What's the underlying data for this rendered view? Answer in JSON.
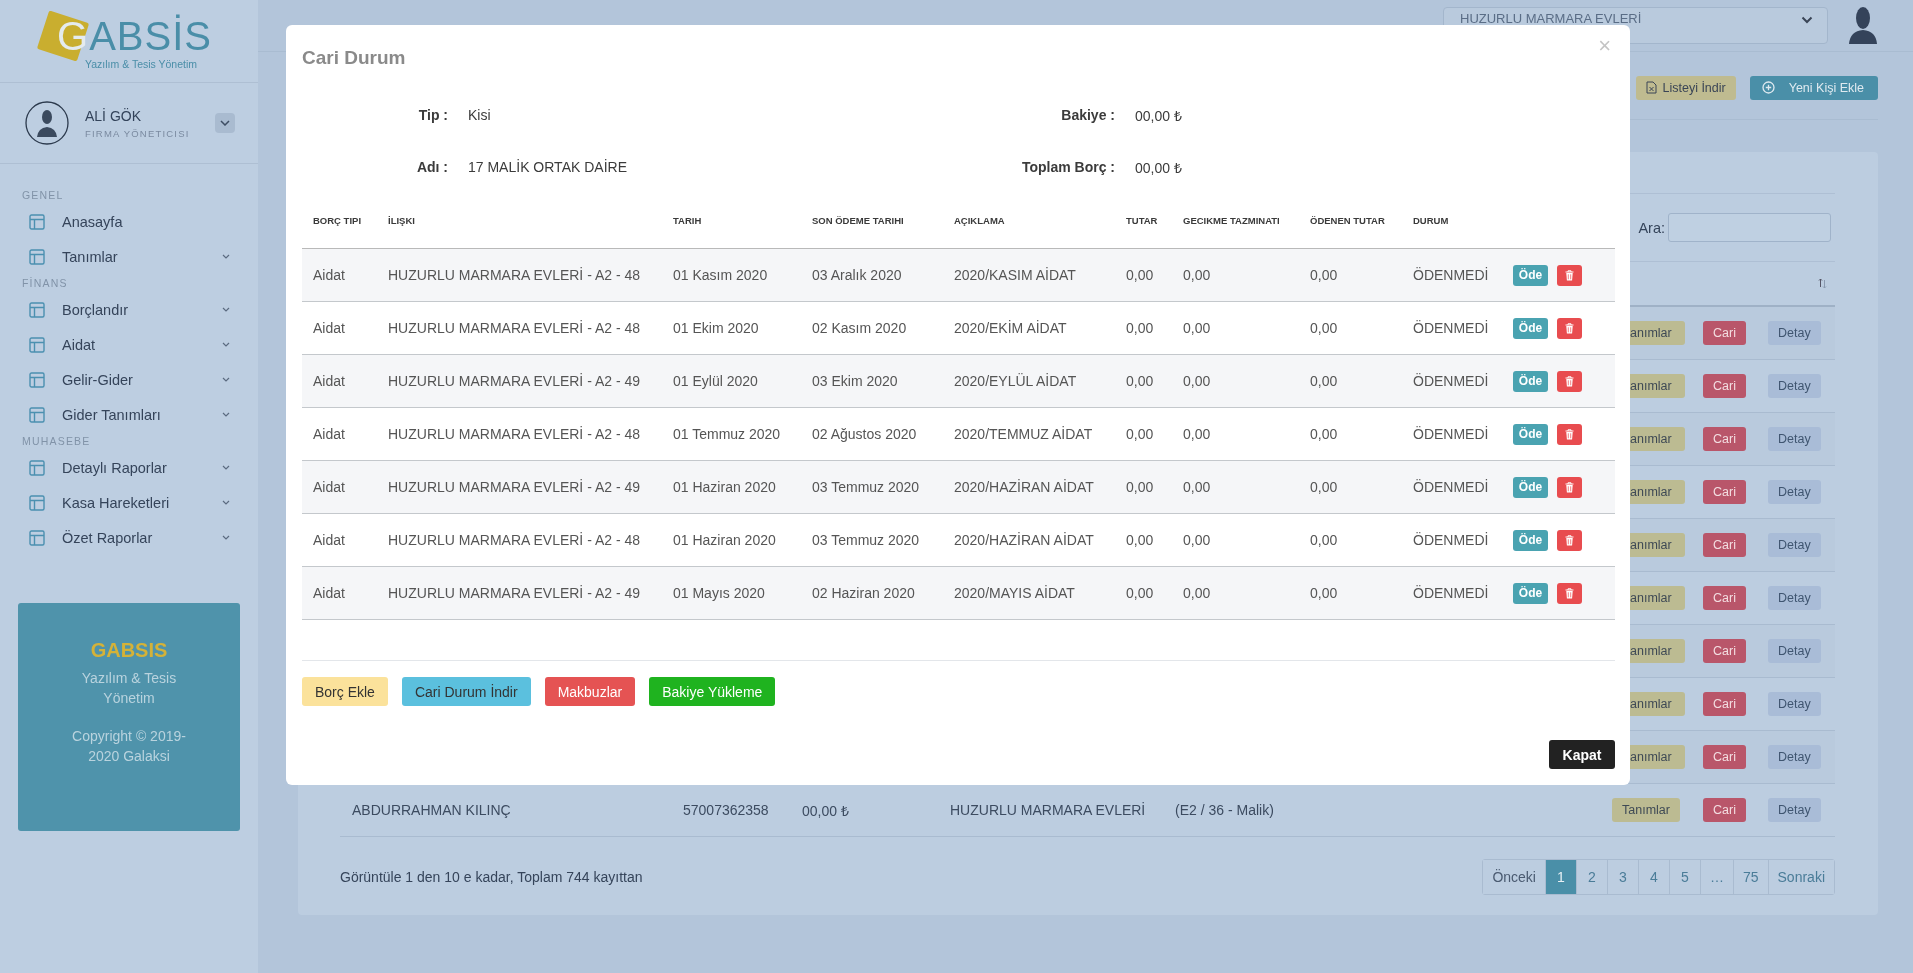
{
  "sidebar": {
    "logo": {
      "name": "GABSİS",
      "tagline": "Yazılım & Tesis Yönetim"
    },
    "user": {
      "name": "ALİ GÖK",
      "role": "FIRMA YÖNETICISI"
    },
    "sections": [
      {
        "title": "GENEL",
        "items": [
          {
            "label": "Anasayfa",
            "expandable": false
          },
          {
            "label": "Tanımlar",
            "expandable": true
          }
        ]
      },
      {
        "title": "FİNANS",
        "items": [
          {
            "label": "Borçlandır",
            "expandable": true
          },
          {
            "label": "Aidat",
            "expandable": true
          },
          {
            "label": "Gelir-Gider",
            "expandable": true
          },
          {
            "label": "Gider Tanımları",
            "expandable": true
          }
        ]
      },
      {
        "title": "MUHASEBE",
        "items": [
          {
            "label": "Detaylı Raporlar",
            "expandable": true
          },
          {
            "label": "Kasa Hareketleri",
            "expandable": true
          },
          {
            "label": "Özet Raporlar",
            "expandable": true
          }
        ]
      }
    ],
    "promo": {
      "title": "GABSIS",
      "text": "Yazılım & Tesis Yönetim",
      "copyright": "Copyright © 2019-2020 Galaksi"
    }
  },
  "topbar": {
    "site": "HUZURLU MARMARA EVLERİ"
  },
  "toolbar": [
    {
      "label": "Listeyi İndir",
      "kind": "download"
    },
    {
      "label": "Yeni Kişi Ekle",
      "kind": "add"
    }
  ],
  "list": {
    "search_label": "Ara:",
    "rows": [
      {
        "actions": [
          {
            "label": "anımlar",
            "kind": "define",
            "cut": true
          },
          {
            "label": "Cari",
            "kind": "account",
            "cut": false
          },
          {
            "label": "Detay",
            "kind": "detail",
            "cut": false
          }
        ]
      },
      {
        "actions": [
          {
            "label": "anımlar",
            "kind": "define",
            "cut": true
          },
          {
            "label": "Cari",
            "kind": "account",
            "cut": false
          },
          {
            "label": "Detay",
            "kind": "detail",
            "cut": false
          }
        ]
      },
      {
        "actions": [
          {
            "label": "anımlar",
            "kind": "define",
            "cut": true
          },
          {
            "label": "Cari",
            "kind": "account",
            "cut": false
          },
          {
            "label": "Detay",
            "kind": "detail",
            "cut": false
          }
        ]
      },
      {
        "actions": [
          {
            "label": "anımlar",
            "kind": "define",
            "cut": true
          },
          {
            "label": "Cari",
            "kind": "account",
            "cut": false
          },
          {
            "label": "Detay",
            "kind": "detail",
            "cut": false
          }
        ]
      },
      {
        "actions": [
          {
            "label": "anımlar",
            "kind": "define",
            "cut": true
          },
          {
            "label": "Cari",
            "kind": "account",
            "cut": false
          },
          {
            "label": "Detay",
            "kind": "detail",
            "cut": false
          }
        ]
      },
      {
        "actions": [
          {
            "label": "anımlar",
            "kind": "define",
            "cut": true
          },
          {
            "label": "Cari",
            "kind": "account",
            "cut": false
          },
          {
            "label": "Detay",
            "kind": "detail",
            "cut": false
          }
        ]
      },
      {
        "actions": [
          {
            "label": "anımlar",
            "kind": "define",
            "cut": true
          },
          {
            "label": "Cari",
            "kind": "account",
            "cut": false
          },
          {
            "label": "Detay",
            "kind": "detail",
            "cut": false
          }
        ]
      },
      {
        "actions": [
          {
            "label": "anımlar",
            "kind": "define",
            "cut": true
          },
          {
            "label": "Cari",
            "kind": "account",
            "cut": false
          },
          {
            "label": "Detay",
            "kind": "detail",
            "cut": false
          }
        ]
      },
      {
        "actions": [
          {
            "label": "anımlar",
            "kind": "define",
            "cut": true
          },
          {
            "label": "Cari",
            "kind": "account",
            "cut": false
          },
          {
            "label": "Detay",
            "kind": "detail",
            "cut": false
          }
        ]
      },
      {
        "cells": [
          "ABDURRAHMAN KILINÇ",
          "57007362358",
          "00,00 ₺",
          "HUZURLU MARMARA EVLERİ",
          "(E2 / 36 - Malik)"
        ],
        "actions": [
          {
            "label": "Tanımlar",
            "kind": "define",
            "cut": false
          },
          {
            "label": "Cari",
            "kind": "account",
            "cut": false
          },
          {
            "label": "Detay",
            "kind": "detail",
            "cut": false
          }
        ]
      }
    ],
    "summary": "Görüntüle 1 den 10 e kadar, Toplam 744 kayıttan",
    "pagination": [
      {
        "label": "Önceki",
        "selected": false
      },
      {
        "label": "1",
        "selected": true
      },
      {
        "label": "2",
        "selected": false
      },
      {
        "label": "3",
        "selected": false
      },
      {
        "label": "4",
        "selected": false
      },
      {
        "label": "5",
        "selected": false
      },
      {
        "label": "…",
        "selected": false
      },
      {
        "label": "75",
        "selected": false
      },
      {
        "label": "Sonraki",
        "selected": false
      }
    ]
  },
  "modal": {
    "title": "Cari Durum",
    "close": "×",
    "info": [
      {
        "label": "Tip :",
        "value": "Kisi"
      },
      {
        "label": "Bakiye :",
        "value": "00,00 ₺"
      },
      {
        "label": "Adı :",
        "value": "17 MALİK ORTAK DAİRE"
      },
      {
        "label": "Toplam Borç :",
        "value": "00,00 ₺"
      }
    ],
    "columns": [
      "BORÇ TIPI",
      "İLIŞKI",
      "TARIH",
      "SON ÖDEME TARIHI",
      "AÇIKLAMA",
      "TUTAR",
      "GECIKME TAZMINATI",
      "ÖDENEN TUTAR",
      "DURUM"
    ],
    "rows": [
      {
        "cells": [
          "Aidat",
          "HUZURLU MARMARA EVLERİ - A2 - 48",
          "01 Kasım 2020",
          "03 Aralık 2020",
          "2020/KASIM AİDAT",
          "0,00",
          "0,00",
          "0,00",
          "ÖDENMEDİ"
        ],
        "pay": "Öde"
      },
      {
        "cells": [
          "Aidat",
          "HUZURLU MARMARA EVLERİ - A2 - 48",
          "01 Ekim 2020",
          "02 Kasım 2020",
          "2020/EKİM AİDAT",
          "0,00",
          "0,00",
          "0,00",
          "ÖDENMEDİ"
        ],
        "pay": "Öde"
      },
      {
        "cells": [
          "Aidat",
          "HUZURLU MARMARA EVLERİ - A2 - 49",
          "01 Eylül 2020",
          "03 Ekim 2020",
          "2020/EYLÜL AİDAT",
          "0,00",
          "0,00",
          "0,00",
          "ÖDENMEDİ"
        ],
        "pay": "Öde"
      },
      {
        "cells": [
          "Aidat",
          "HUZURLU MARMARA EVLERİ - A2 - 48",
          "01 Temmuz 2020",
          "02 Ağustos 2020",
          "2020/TEMMUZ AİDAT",
          "0,00",
          "0,00",
          "0,00",
          "ÖDENMEDİ"
        ],
        "pay": "Öde"
      },
      {
        "cells": [
          "Aidat",
          "HUZURLU MARMARA EVLERİ - A2 - 49",
          "01 Haziran 2020",
          "03 Temmuz 2020",
          "2020/HAZİRAN AİDAT",
          "0,00",
          "0,00",
          "0,00",
          "ÖDENMEDİ"
        ],
        "pay": "Öde"
      },
      {
        "cells": [
          "Aidat",
          "HUZURLU MARMARA EVLERİ - A2 - 48",
          "01 Haziran 2020",
          "03 Temmuz 2020",
          "2020/HAZİRAN AİDAT",
          "0,00",
          "0,00",
          "0,00",
          "ÖDENMEDİ"
        ],
        "pay": "Öde"
      },
      {
        "cells": [
          "Aidat",
          "HUZURLU MARMARA EVLERİ - A2 - 49",
          "01 Mayıs 2020",
          "02 Haziran 2020",
          "2020/MAYIS AİDAT",
          "0,00",
          "0,00",
          "0,00",
          "ÖDENMEDİ"
        ],
        "pay": "Öde"
      }
    ],
    "buttons": [
      {
        "label": "Borç Ekle",
        "kind": "warning"
      },
      {
        "label": "Cari Durum İndir",
        "kind": "info"
      },
      {
        "label": "Makbuzlar",
        "kind": "danger"
      },
      {
        "label": "Bakiye Yükleme",
        "kind": "success"
      }
    ],
    "close_button": "Kapat"
  }
}
